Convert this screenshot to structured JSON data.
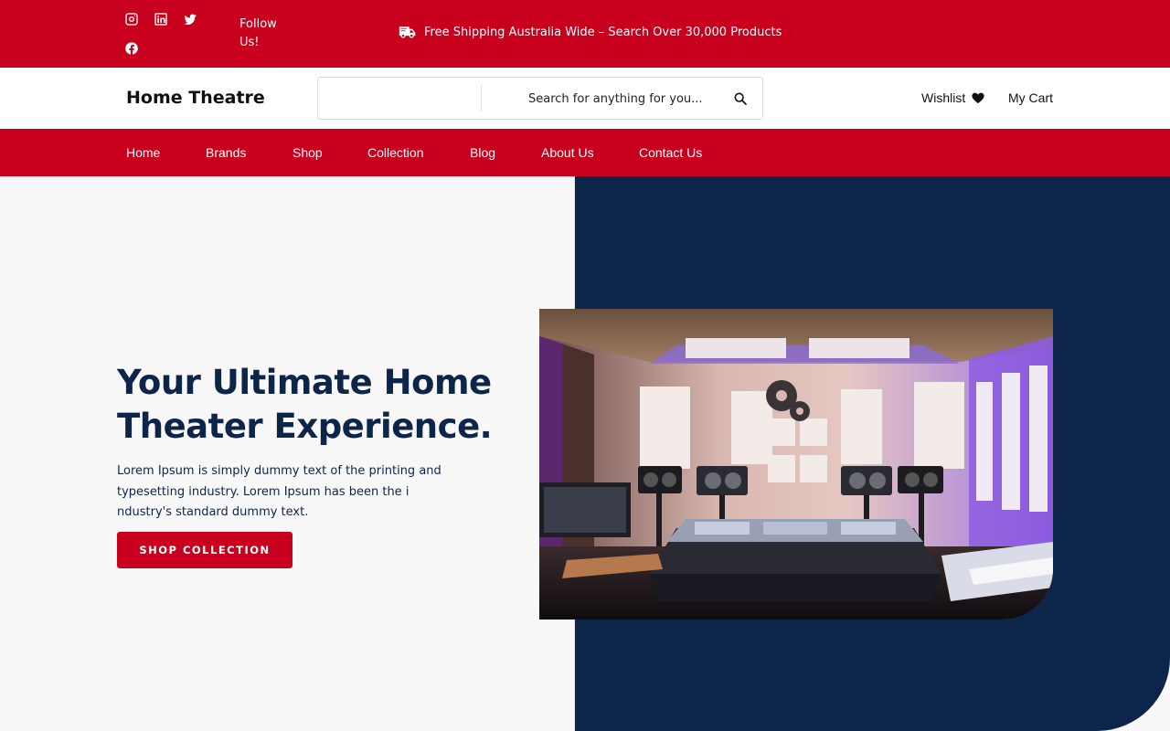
{
  "topbar": {
    "follow_text": "Follow Us!",
    "shipping_text": "Free Shipping Australia Wide – Search Over 30,000 Products",
    "social_icons": [
      "instagram-icon",
      "linkedin-icon",
      "twitter-icon",
      "facebook-icon"
    ]
  },
  "header": {
    "logo": "Home Theatre",
    "search_placeholder": "Search for anything for you...",
    "wishlist_label": "Wishlist",
    "cart_label": "My Cart"
  },
  "nav": {
    "items": [
      "Home",
      "Brands",
      "Shop",
      "Collection",
      "Blog",
      "About Us",
      "Contact Us"
    ]
  },
  "hero": {
    "title": "Your Ultimate Home Theater Experience.",
    "description": "Lorem Ipsum is simply dummy text of the printing and typesetting industry. Lorem Ipsum has been the i ndustry's standard dummy text.",
    "button_label": "SHOP COLLECTION"
  },
  "colors": {
    "brand_red": "#c8001e",
    "navy": "#0d2548",
    "background": "#f8f8f8"
  }
}
